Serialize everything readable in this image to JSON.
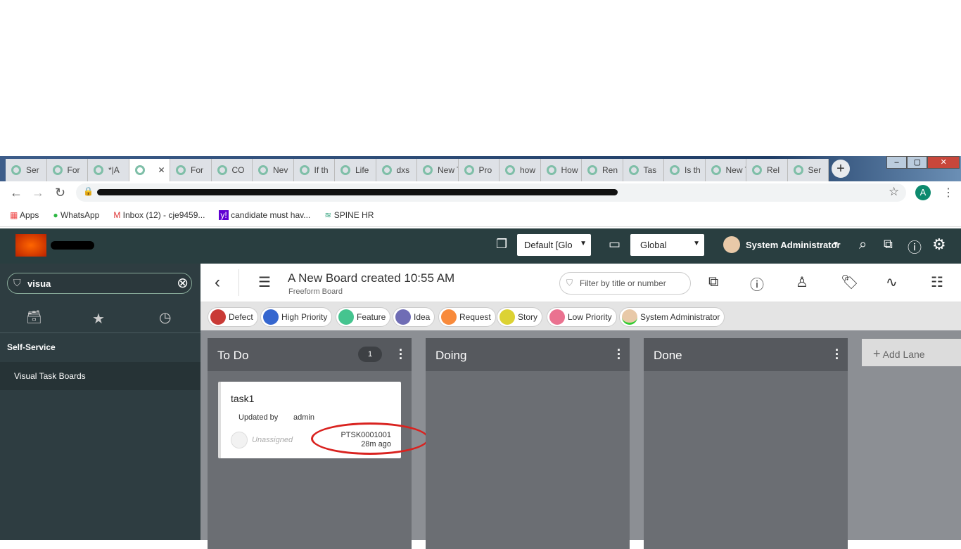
{
  "browser": {
    "tabs": [
      "Ser",
      "For",
      "*|A",
      "",
      "For",
      "CO",
      "Nev",
      "If th",
      "Life",
      "dxs",
      "New Tal",
      "Pro",
      "how",
      "How",
      "Ren",
      "Tas",
      "Is th",
      "New Tal",
      "Rel",
      "Ser"
    ],
    "active_tab_index": 3,
    "profile_initial": "A",
    "bookmarks": [
      "Apps",
      "WhatsApp",
      "Inbox (12) - cje9459...",
      "candidate must hav...",
      "SPINE HR"
    ]
  },
  "header": {
    "scope_select": "Default [Glo",
    "domain_select": "Global",
    "user_name": "System Administrator"
  },
  "sidebar": {
    "filter_value": "visua",
    "section": "Self-Service",
    "item": "Visual Task Boards"
  },
  "board": {
    "title": "A New Board created 10:55 AM",
    "subtitle": "Freeform Board",
    "filter_placeholder": "Filter by title or number",
    "tags": [
      {
        "label": "Defect",
        "color": "#c93a36"
      },
      {
        "label": "High Priority",
        "color": "#3566cf"
      },
      {
        "label": "Feature",
        "color": "#45c48f"
      },
      {
        "label": "Idea",
        "color": "#6f6db5"
      },
      {
        "label": "Request",
        "color": "#f88a3b"
      },
      {
        "label": "Story",
        "color": "#dcd233"
      },
      {
        "label": "Low Priority",
        "color": "#ea7290"
      }
    ],
    "member": "System Administrator",
    "lanes": [
      {
        "name": "To Do",
        "count": "1"
      },
      {
        "name": "Doing"
      },
      {
        "name": "Done"
      }
    ],
    "add_lane": "Add Lane",
    "card": {
      "title": "task1",
      "updated_label": "Updated by",
      "updated_by": "admin",
      "assignee": "Unassigned",
      "number": "PTSK0001001",
      "age": "28m ago"
    }
  }
}
